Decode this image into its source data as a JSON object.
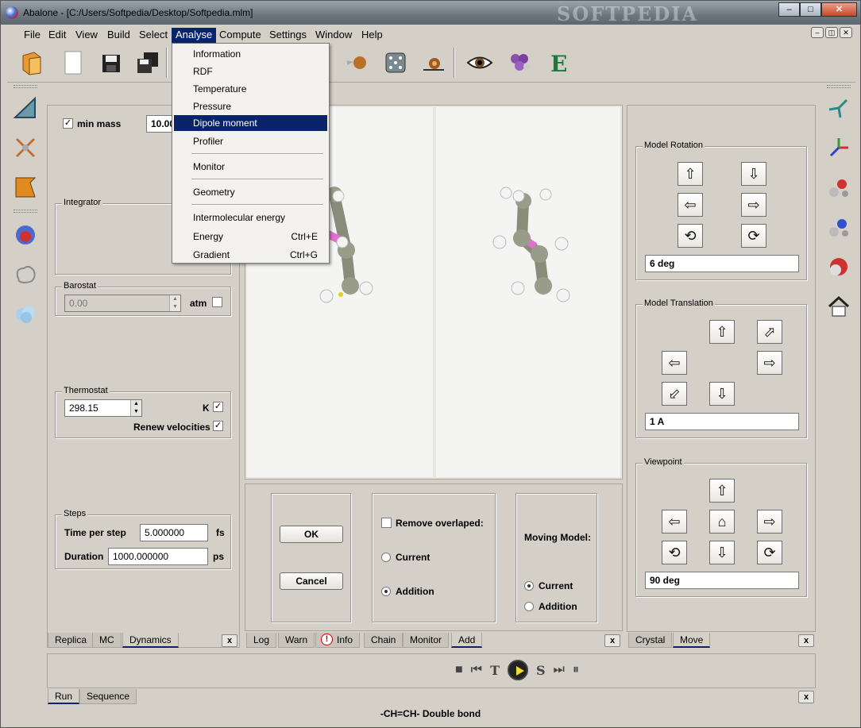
{
  "window": {
    "title": "Abalone - [C:/Users/Softpedia/Desktop/Softpedia.mlm]",
    "watermark": "SOFTPEDIA",
    "btn_min": "–",
    "btn_max": "□",
    "btn_close": "✕"
  },
  "menubar": {
    "items": [
      "File",
      "Edit",
      "View",
      "Build",
      "Select",
      "Analyse",
      "Compute",
      "Settings",
      "Window",
      "Help"
    ],
    "active": "Analyse",
    "mdi_min": "–",
    "mdi_restore": "◫",
    "mdi_close": "✕"
  },
  "analyse_menu": {
    "items": [
      {
        "label": "Information",
        "shortcut": ""
      },
      {
        "label": "RDF",
        "shortcut": ""
      },
      {
        "label": "Temperature",
        "shortcut": ""
      },
      {
        "label": "Pressure",
        "shortcut": ""
      },
      {
        "label": "Dipole moment",
        "shortcut": ""
      },
      {
        "label": "Profiler",
        "shortcut": ""
      },
      {
        "label": "Monitor",
        "shortcut": ""
      },
      {
        "label": "Geometry",
        "shortcut": ""
      },
      {
        "label": "Intermolecular energy",
        "shortcut": ""
      },
      {
        "label": "Energy",
        "shortcut": "Ctrl+E"
      },
      {
        "label": "Gradient",
        "shortcut": "Ctrl+G"
      }
    ],
    "highlighted": "Dipole moment"
  },
  "left_panel": {
    "min_mass": {
      "label": "min mass",
      "checked": true,
      "value": "10.00"
    },
    "integrator": {
      "legend": "Integrator"
    },
    "barostat": {
      "legend": "Barostat",
      "value": "0.00",
      "unit": "atm",
      "checked": false
    },
    "thermostat": {
      "legend": "Thermostat",
      "value": "298.15",
      "unit": "K",
      "unit_checked": true,
      "renew_label": "Renew velocities",
      "renew_checked": true
    },
    "steps": {
      "legend": "Steps",
      "time_label": "Time per step",
      "time_value": "5.000000",
      "time_unit": "fs",
      "duration_label": "Duration",
      "duration_value": "1000.000000",
      "duration_unit": "ps"
    },
    "tabs": [
      "Replica",
      "MC",
      "Dynamics"
    ],
    "active_tab": "Dynamics"
  },
  "add_panel": {
    "ok": "OK",
    "cancel": "Cancel",
    "remove_overlaped": "Remove overlaped:",
    "current": "Current",
    "addition": "Addition",
    "moving_model": "Moving Model:",
    "moving_current": "Current",
    "moving_addition": "Addition"
  },
  "bottom_tabs": [
    "Log",
    "Warn",
    "Info",
    "Chain",
    "Monitor",
    "Add"
  ],
  "bottom_active": "Add",
  "right_panel": {
    "rotation": {
      "legend": "Model Rotation",
      "value": "6 deg"
    },
    "translation": {
      "legend": "Model Translation",
      "value": "1 A"
    },
    "viewpoint": {
      "legend": "Viewpoint",
      "value": "90 deg"
    },
    "tabs": [
      "Crystal",
      "Move"
    ],
    "active_tab": "Move"
  },
  "run_panel": {
    "tabs": [
      "Run",
      "Sequence"
    ],
    "active_tab": "Run",
    "controls": [
      "■",
      "⏮",
      "T",
      "play",
      "S",
      "⏭",
      "⏸"
    ]
  },
  "status": "-CH=CH- Double bond",
  "colors": {
    "accent": "#0a246a",
    "bg": "#d4d0c8",
    "viewport": "#f4f4f2"
  }
}
